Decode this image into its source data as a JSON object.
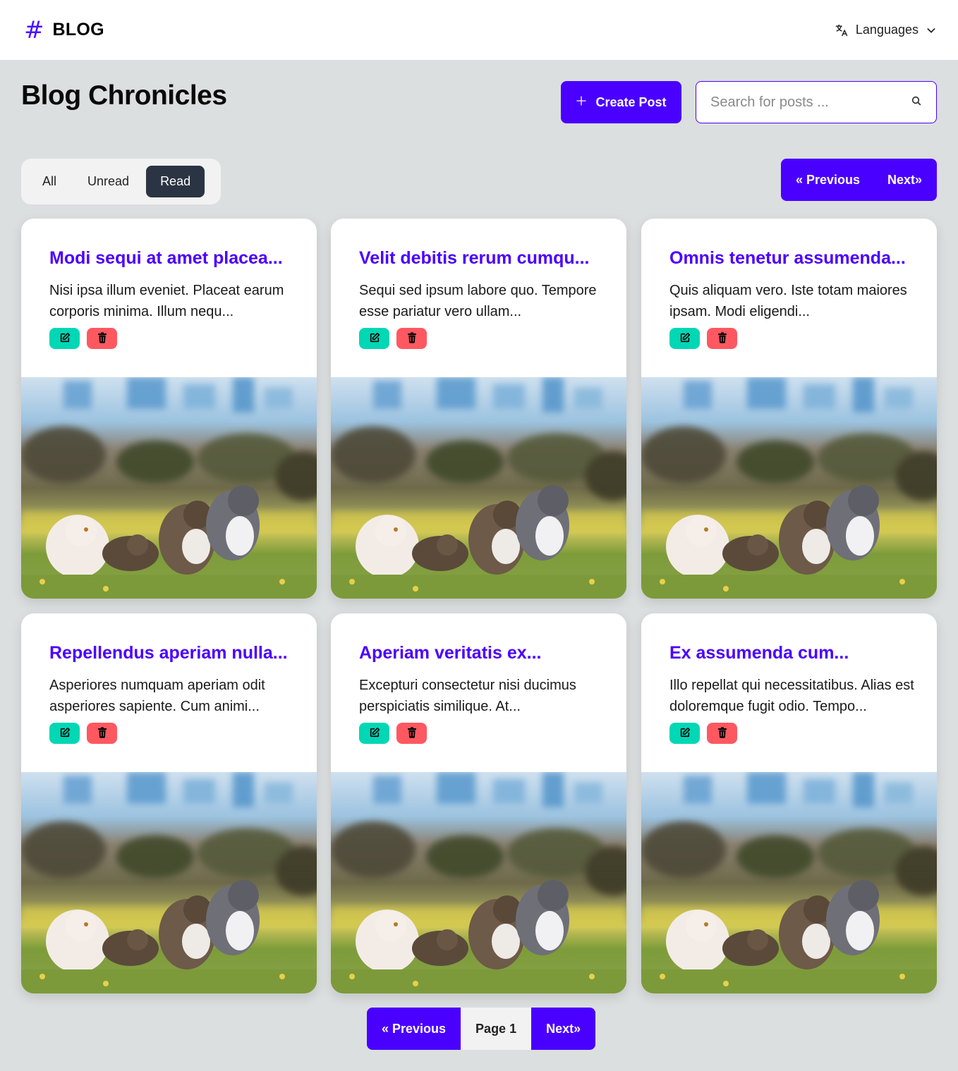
{
  "header": {
    "brand_symbol": "#",
    "brand_name": "BLOG",
    "languages_label": "Languages"
  },
  "page": {
    "title": "Blog Chronicles",
    "create_label": "Create Post",
    "search_placeholder": "Search for posts ..."
  },
  "filters": [
    {
      "label": "All",
      "active": false
    },
    {
      "label": "Unread",
      "active": false
    },
    {
      "label": "Read",
      "active": true
    }
  ],
  "pager_top": {
    "prev": "« Previous",
    "next": "Next»"
  },
  "posts": [
    {
      "title": "Modi sequi at amet placea...",
      "excerpt": "Nisi ipsa illum eveniet. Placeat earum corporis minima. Illum nequ..."
    },
    {
      "title": "Velit debitis rerum cumqu...",
      "excerpt": "Sequi sed ipsum labore quo. Tempore esse pariatur vero ullam..."
    },
    {
      "title": "Omnis tenetur assumenda...",
      "excerpt": "Quis aliquam vero. Iste totam maiores ipsam. Modi eligendi..."
    },
    {
      "title": "Repellendus aperiam nulla...",
      "excerpt": "Asperiores numquam aperiam odit asperiores sapiente. Cum animi..."
    },
    {
      "title": "Aperiam veritatis ex...",
      "excerpt": "Excepturi consectetur nisi ducimus perspiciatis similique. At..."
    },
    {
      "title": "Ex assumenda cum...",
      "excerpt": "Illo repellat qui necessitatibus. Alias est doloremque fugit odio. Tempo..."
    }
  ],
  "pager_bottom": {
    "prev": "« Previous",
    "page": "Page 1",
    "next": "Next»"
  },
  "colors": {
    "accent": "#4a00ff",
    "edit": "#00d7b5",
    "delete": "#ff5861",
    "active_tab": "#2b3443",
    "background": "#dcdfdf"
  },
  "icons": {
    "brand": "hash-icon",
    "languages": "translate-icon",
    "dropdown": "chevron-down-icon",
    "create": "plus-icon",
    "search": "search-icon",
    "edit": "edit-icon",
    "delete": "trash-icon"
  }
}
